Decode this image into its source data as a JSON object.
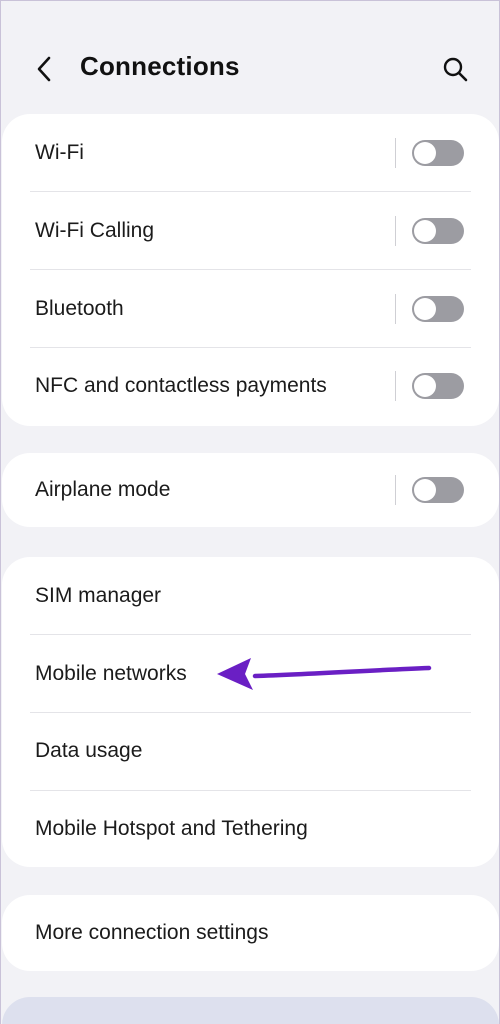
{
  "header": {
    "title": "Connections",
    "back_icon": "chevron-left-icon",
    "search_icon": "search-icon"
  },
  "groups": [
    {
      "items": [
        {
          "label": "Wi-Fi",
          "toggle": false
        },
        {
          "label": "Wi-Fi Calling",
          "toggle": false
        },
        {
          "label": "Bluetooth",
          "toggle": false
        },
        {
          "label": "NFC and contactless payments",
          "toggle": false
        }
      ]
    },
    {
      "items": [
        {
          "label": "Airplane mode",
          "toggle": false
        }
      ]
    },
    {
      "items": [
        {
          "label": "SIM manager"
        },
        {
          "label": "Mobile networks"
        },
        {
          "label": "Data usage"
        },
        {
          "label": "Mobile Hotspot and Tethering"
        }
      ]
    },
    {
      "items": [
        {
          "label": "More connection settings"
        }
      ]
    }
  ],
  "annotation": {
    "icon": "arrow-icon",
    "color": "#6a1fc4",
    "points_to": "Mobile networks"
  },
  "colors": {
    "background": "#f2f2f6",
    "card": "#ffffff",
    "toggle_off": "#9c9ca2"
  }
}
